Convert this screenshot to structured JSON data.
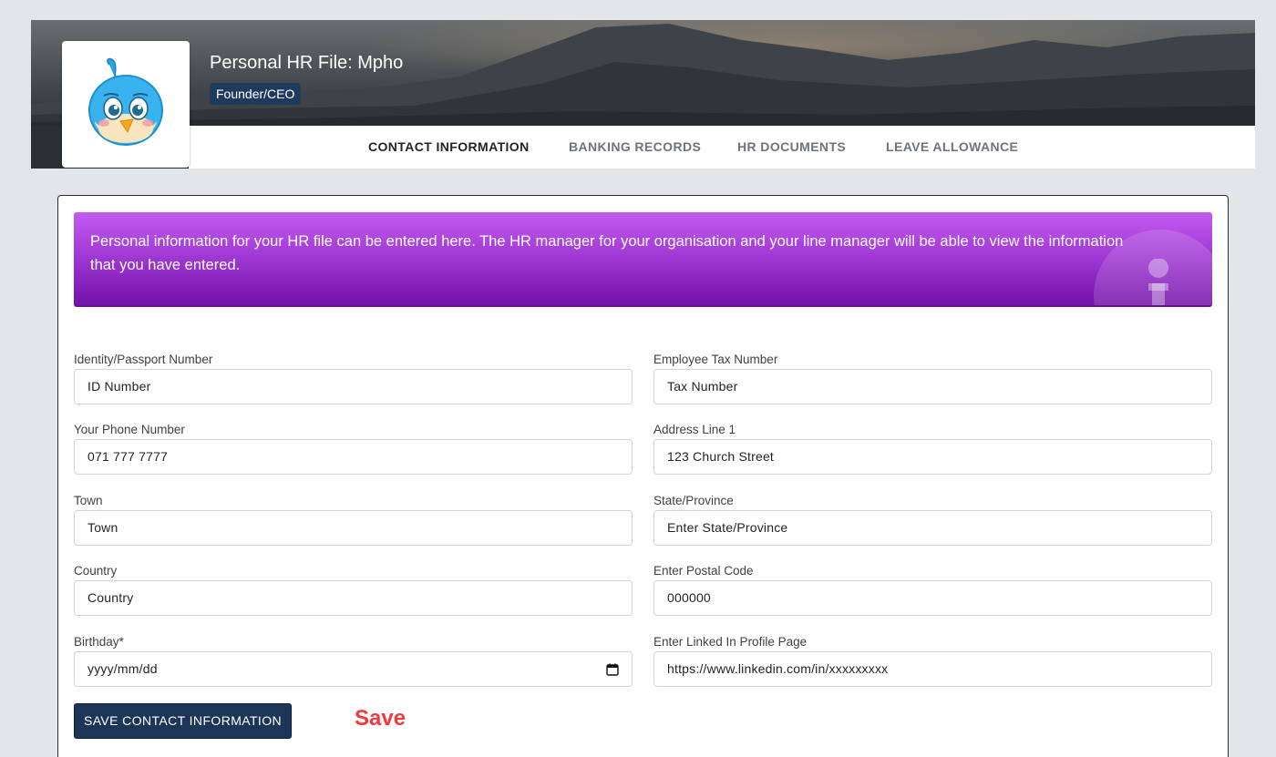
{
  "header": {
    "title": "Personal HR File: Mpho",
    "role_badge": "Founder/CEO",
    "avatar_icon": "bird-avatar-icon"
  },
  "tabs": [
    {
      "label": "CONTACT INFORMATION",
      "active": true
    },
    {
      "label": "BANKING RECORDS",
      "active": false
    },
    {
      "label": "HR DOCUMENTS",
      "active": false
    },
    {
      "label": "LEAVE ALLOWANCE",
      "active": false
    }
  ],
  "info_alert": {
    "text": "Personal information for your HR file can be entered here. The HR manager for your organisation and your line manager will be able to view the information that you have entered.",
    "icon": "info-icon"
  },
  "form": {
    "id_number": {
      "label": "Identity/Passport Number",
      "placeholder": "ID Number"
    },
    "tax_number": {
      "label": "Employee Tax Number",
      "placeholder": "Tax Number"
    },
    "phone": {
      "label": "Your Phone Number",
      "placeholder": "071 777 7777"
    },
    "address_line1": {
      "label": "Address Line 1",
      "placeholder": "123 Church Street"
    },
    "town": {
      "label": "Town",
      "placeholder": "Town"
    },
    "state": {
      "label": "State/Province",
      "placeholder": "Enter State/Province"
    },
    "country": {
      "label": "Country",
      "placeholder": "Country"
    },
    "postal_code": {
      "label": "Enter Postal Code",
      "placeholder": "000000"
    },
    "birthday": {
      "label": "Birthday*",
      "placeholder": "yyyy/mm/dd"
    },
    "linkedin": {
      "label": "Enter Linked In Profile Page",
      "placeholder": "https://www.linkedin.com/in/xxxxxxxxx"
    }
  },
  "save_button": {
    "label": "SAVE CONTACT INFORMATION"
  },
  "annotation": {
    "text": "Save",
    "color": "#ee3b3b"
  },
  "colors": {
    "badge_bg": "#1f3b5c",
    "button_bg": "#1d3557",
    "alert_top": "#c45af0",
    "alert_bottom": "#7311a8"
  }
}
